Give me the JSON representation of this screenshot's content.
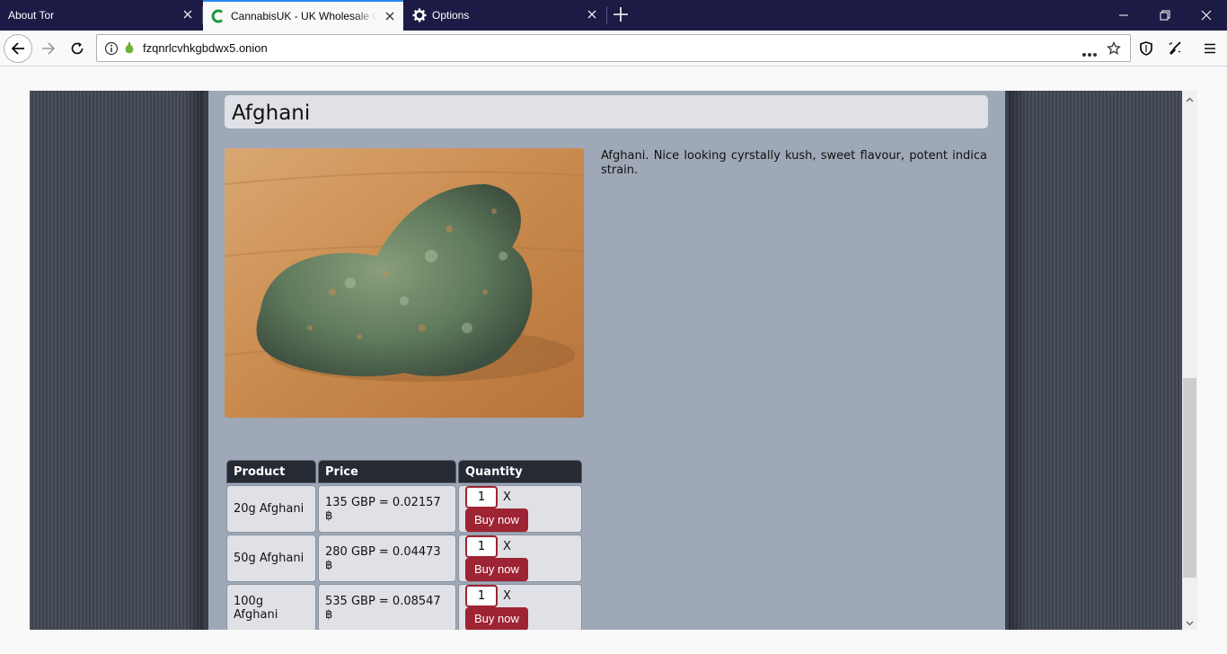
{
  "browser": {
    "tabs": [
      {
        "label": "About Tor",
        "active": false,
        "icon": "none"
      },
      {
        "label": "CannabisUK - UK Wholesale Cannabis",
        "active": true,
        "icon": "cannabisuk-favicon"
      },
      {
        "label": "Options",
        "active": false,
        "icon": "gear-icon"
      }
    ],
    "url": "fzqnrlcvhkgbdwx5.onion",
    "accent_color": "#2a88f2",
    "tabstrip_color": "#1c1b45"
  },
  "product": {
    "title": "Afghani",
    "description": "Afghani. Nice looking cyrstally kush, sweet flavour, potent indica strain.",
    "image_alt": "cannabis bud on wooden table"
  },
  "price_table": {
    "headers": {
      "product": "Product",
      "price": "Price",
      "quantity": "Quantity"
    },
    "rows": [
      {
        "product": "20g Afghani",
        "price": "135 GBP = 0.02157 ฿",
        "qty": "1",
        "times": "X",
        "button": "Buy now"
      },
      {
        "product": "50g Afghani",
        "price": "280 GBP = 0.04473 ฿",
        "qty": "1",
        "times": "X",
        "button": "Buy now"
      },
      {
        "product": "100g Afghani",
        "price": "535 GBP = 0.08547 ฿",
        "qty": "1",
        "times": "X",
        "button": "Buy now"
      }
    ]
  },
  "colors": {
    "panel_bg": "#9fa8b6",
    "button": "#9e2433",
    "header_cell": "#252a33"
  }
}
